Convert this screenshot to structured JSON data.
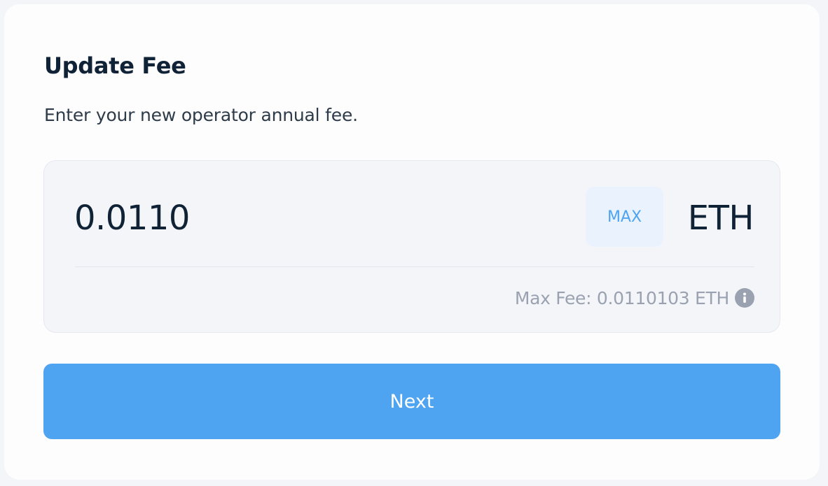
{
  "dialog": {
    "title": "Update Fee",
    "subtitle": "Enter your new operator annual fee."
  },
  "fee_input": {
    "value": "0.0110",
    "max_label": "MAX",
    "currency": "ETH",
    "max_fee_text": "Max Fee: 0.0110103 ETH",
    "info_icon": "info-icon"
  },
  "actions": {
    "next_label": "Next"
  },
  "colors": {
    "accent": "#4fa4f2",
    "max_button_bg": "#eaf3fd",
    "text_primary": "#0f2236",
    "text_muted": "#9aa2b1",
    "panel_bg": "#f4f5f9"
  }
}
